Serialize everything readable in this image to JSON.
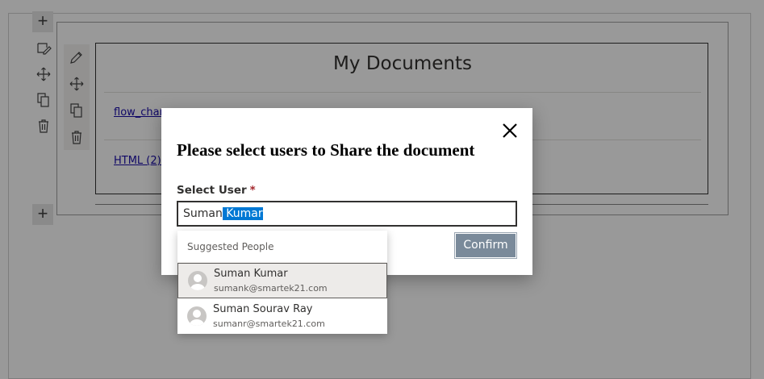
{
  "page": {
    "add_section_label": "+",
    "documents_title": "My Documents",
    "documents": [
      {
        "name": "flow_char"
      },
      {
        "name": "HTML (2)."
      }
    ]
  },
  "modal": {
    "heading": "Please select users to Share the document",
    "field_label": "Select User",
    "required_marker": "*",
    "input_value_plain": "Suman",
    "input_value_selected": " Kumar",
    "confirm_label": "Confirm",
    "close_icon": "close-icon"
  },
  "suggestions": {
    "header": "Suggested People",
    "people": [
      {
        "name": "Suman Kumar",
        "email": "sumank@smartek21.com"
      },
      {
        "name": "Suman Sourav Ray",
        "email": "sumanr@smartek21.com"
      }
    ]
  },
  "colors": {
    "overlay": "rgba(0,0,0,0.4)",
    "selection": "#0078d4",
    "confirm_bg": "#7a8a9a",
    "required": "#a4262c"
  }
}
